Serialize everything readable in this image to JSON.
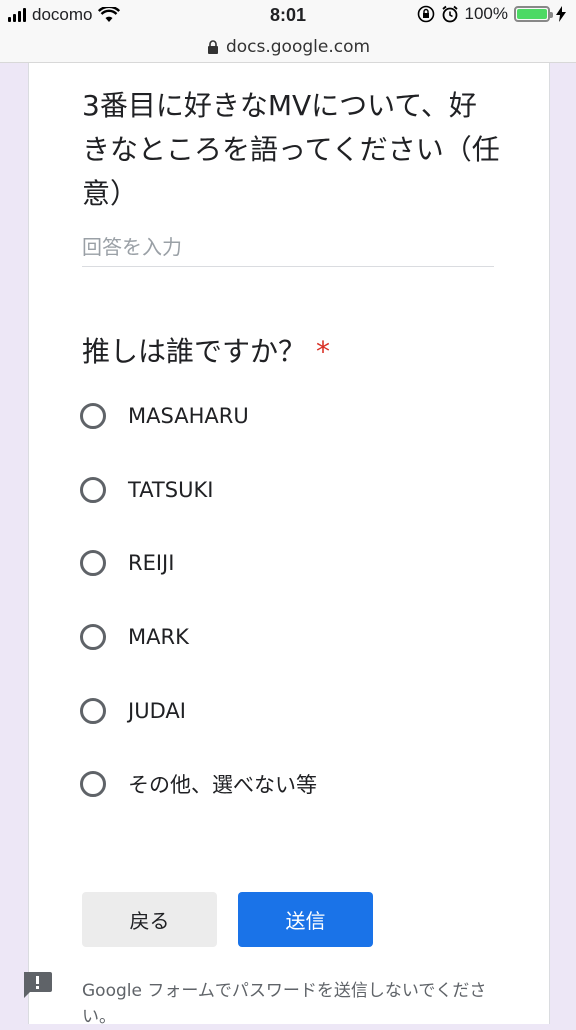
{
  "status_bar": {
    "carrier": "docomo",
    "time": "8:01",
    "battery": "100%",
    "battery_level": 1.0
  },
  "url_bar": {
    "host": "docs.google.com"
  },
  "question1": {
    "title": "3番目に好きなMVについて、好きなところを語ってください（任意）",
    "placeholder": "回答を入力"
  },
  "question2": {
    "title": "推しは誰ですか？",
    "required_mark": "*",
    "options": [
      "MASAHARU",
      "TATSUKI",
      "REIJI",
      "MARK",
      "JUDAI",
      "その他、選べない等"
    ]
  },
  "buttons": {
    "back": "戻る",
    "submit": "送信"
  },
  "footer": {
    "note": "Google フォームでパスワードを送信しないでください。"
  },
  "colors": {
    "accent": "#1a73e8",
    "required": "#d93025",
    "background": "#ede7f6"
  },
  "icons": [
    "wifi-icon",
    "lock-icon",
    "orientation-lock-icon",
    "alarm-icon",
    "charging-icon",
    "feedback-icon"
  ]
}
